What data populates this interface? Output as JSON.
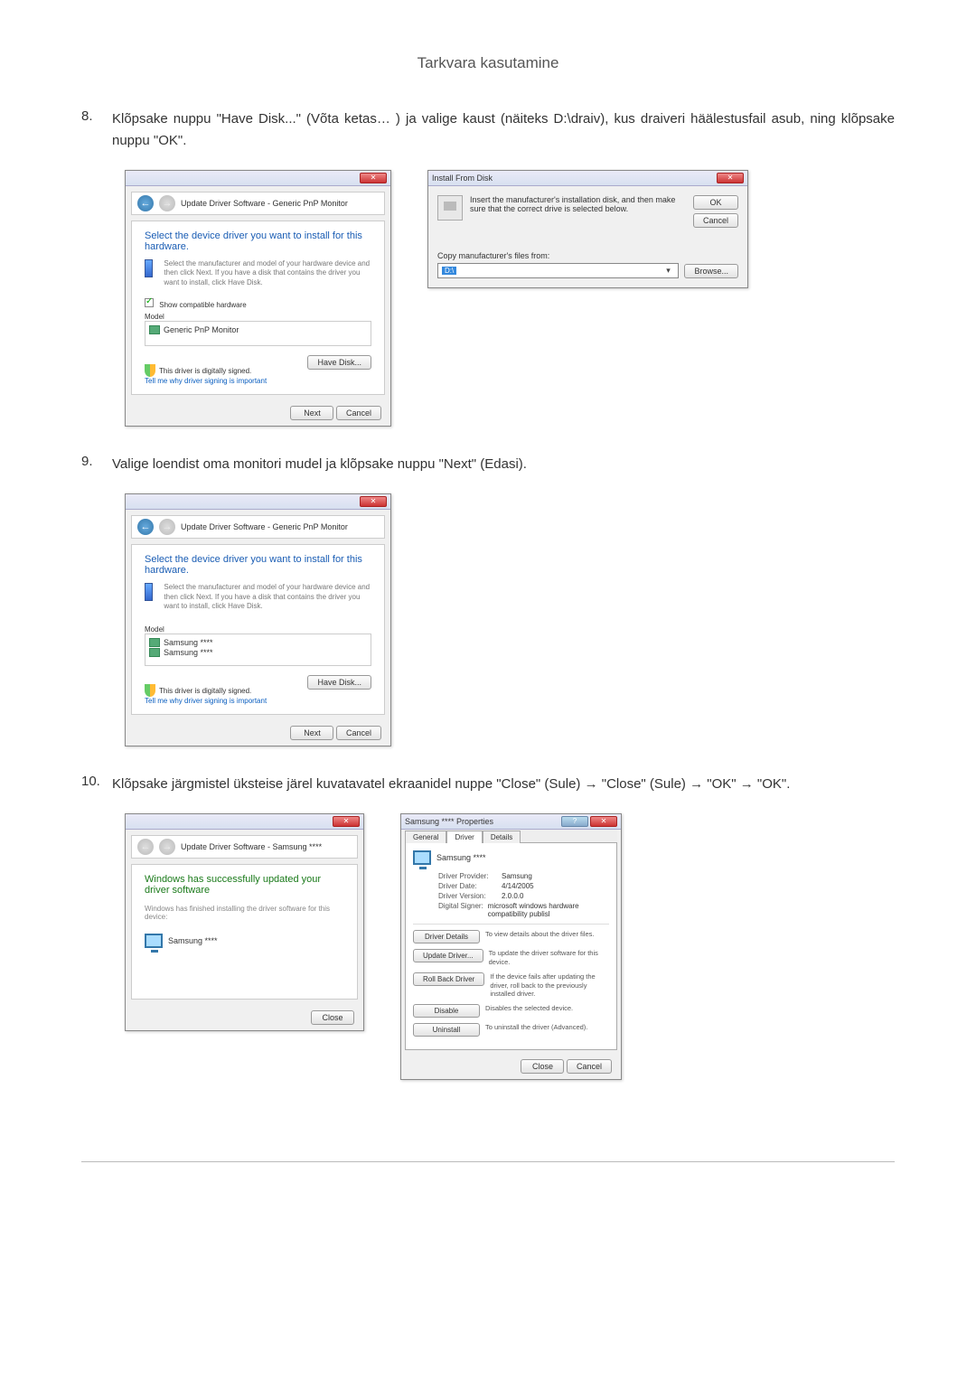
{
  "page_header": "Tarkvara kasutamine",
  "step8": {
    "num": "8.",
    "text": "Klõpsake nuppu \"Have Disk...\" (Võta ketas… ) ja valige kaust (näiteks D:\\draiv), kus draiveri häälestusfail asub, ning klõpsake nuppu \"OK\"."
  },
  "step9": {
    "num": "9.",
    "text": "Valige loendist oma monitori mudel ja klõpsake nuppu \"Next\" (Edasi)."
  },
  "step10": {
    "num": "10.",
    "text": "Klõpsake järgmistel üksteise järel kuvatavatel ekraanidel nuppe \"Close\" (Sule) → \"Close\" (Sule) → \"OK\" → \"OK\"."
  },
  "wizard1": {
    "crumb": "Update Driver Software - Generic PnP Monitor",
    "heading": "Select the device driver you want to install for this hardware.",
    "sub": "Select the manufacturer and model of your hardware device and then click Next. If you have a disk that contains the driver you want to install, click Have Disk.",
    "show_compatible": "Show compatible hardware",
    "model_label": "Model",
    "model_item": "Generic PnP Monitor",
    "signed": "This driver is digitally signed.",
    "signed_link": "Tell me why driver signing is important",
    "have_disk": "Have Disk...",
    "next": "Next",
    "cancel": "Cancel"
  },
  "ifd": {
    "title": "Install From Disk",
    "msg": "Insert the manufacturer's installation disk, and then make sure that the correct drive is selected below.",
    "ok": "OK",
    "cancel": "Cancel",
    "copy_from": "Copy manufacturer's files from:",
    "path": "D:\\",
    "browse": "Browse..."
  },
  "wizard2": {
    "crumb": "Update Driver Software - Generic PnP Monitor",
    "heading": "Select the device driver you want to install for this hardware.",
    "sub": "Select the manufacturer and model of your hardware device and then click Next. If you have a disk that contains the driver you want to install, click Have Disk.",
    "model_label": "Model",
    "model_item1": "Samsung ****",
    "model_item2": "Samsung ****",
    "signed": "This driver is digitally signed.",
    "signed_link": "Tell me why driver signing is important",
    "have_disk": "Have Disk...",
    "next": "Next",
    "cancel": "Cancel"
  },
  "done": {
    "crumb": "Update Driver Software - Samsung ****",
    "heading": "Windows has successfully updated your driver software",
    "sub": "Windows has finished installing the driver software for this device:",
    "device": "Samsung ****",
    "close": "Close"
  },
  "props": {
    "title": "Samsung **** Properties",
    "tabs": {
      "general": "General",
      "driver": "Driver",
      "details": "Details"
    },
    "device": "Samsung ****",
    "provider_k": "Driver Provider:",
    "provider_v": "Samsung",
    "date_k": "Driver Date:",
    "date_v": "4/14/2005",
    "version_k": "Driver Version:",
    "version_v": "2.0.0.0",
    "signer_k": "Digital Signer:",
    "signer_v": "microsoft windows hardware compatibility publisl",
    "details_btn": "Driver Details",
    "details_desc": "To view details about the driver files.",
    "update_btn": "Update Driver...",
    "update_desc": "To update the driver software for this device.",
    "rollback_btn": "Roll Back Driver",
    "rollback_desc": "If the device fails after updating the driver, roll back to the previously installed driver.",
    "disable_btn": "Disable",
    "disable_desc": "Disables the selected device.",
    "uninstall_btn": "Uninstall",
    "uninstall_desc": "To uninstall the driver (Advanced).",
    "close": "Close",
    "cancel": "Cancel"
  }
}
